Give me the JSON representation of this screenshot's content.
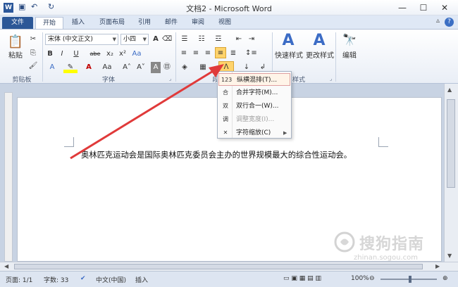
{
  "window": {
    "title": "文档2 - Microsoft Word",
    "app_icon": "W",
    "qa_icons": [
      "save-icon",
      "undo-icon",
      "redo-icon"
    ],
    "buttons": {
      "minimize": "—",
      "maximize": "☐",
      "close": "✕"
    }
  },
  "ribbon_tabs": [
    "文件",
    "开始",
    "插入",
    "页面布局",
    "引用",
    "邮件",
    "审阅",
    "视图"
  ],
  "ribbon": {
    "clipboard": {
      "paste": "粘贴",
      "label": "剪贴板"
    },
    "font": {
      "font_name": "宋体 (中文正文)",
      "font_size": "小四",
      "bold": "B",
      "italic": "I",
      "underline": "U",
      "strike": "abe",
      "subscript": "x₂",
      "superscript": "x²",
      "label": "字体"
    },
    "paragraph": {
      "label": "段"
    },
    "styles": {
      "quick": "快速样式",
      "change": "更改样式",
      "label": "样式"
    },
    "editing": {
      "label": "编辑"
    }
  },
  "menu": {
    "items": [
      {
        "label": "纵横混排(T)...",
        "icon": "123",
        "disabled": false,
        "highlight": true
      },
      {
        "label": "合并字符(M)...",
        "icon": "合",
        "disabled": false,
        "highlight": false
      },
      {
        "label": "双行合一(W)...",
        "icon": "双",
        "disabled": false,
        "highlight": false
      },
      {
        "label": "调整宽度(I)...",
        "icon": "调",
        "disabled": true,
        "highlight": false
      },
      {
        "label": "字符缩放(C)",
        "icon": "✕",
        "disabled": false,
        "highlight": false
      }
    ]
  },
  "document": {
    "text": "奥林匹克运动会是国际奥林匹克委员会主办的世界规模最大的综合性运动会。"
  },
  "status": {
    "page": "页面: 1/1",
    "words": "字数: 33",
    "language": "中文(中国)",
    "mode": "插入",
    "zoom": "100%"
  },
  "watermark": {
    "text": "搜狗指南",
    "url": "zhinan.sogou.com"
  },
  "colors": {
    "accent": "#2b5797",
    "arrow": "#e03a3a"
  }
}
